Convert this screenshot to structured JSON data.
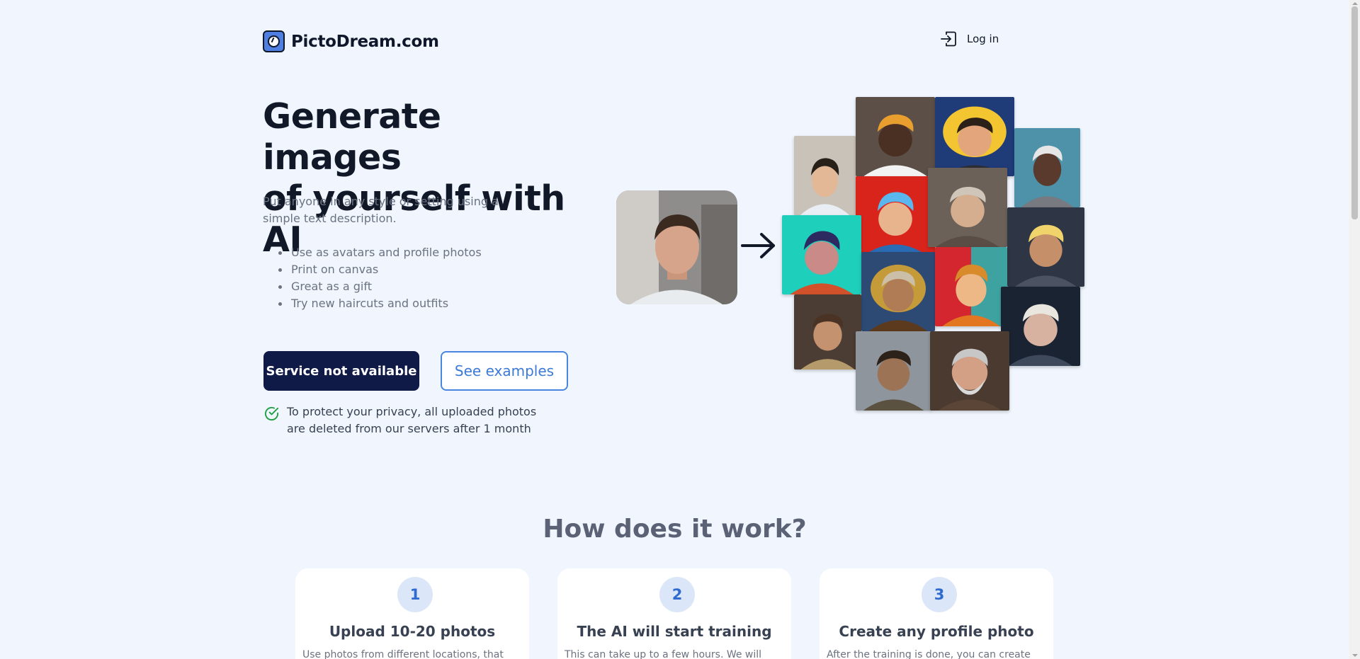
{
  "header": {
    "brand": "PictoDream.com",
    "login_label": "Log in"
  },
  "hero": {
    "title_line1": "Generate images",
    "title_line2": "of yourself with AI",
    "subtitle": "Put anyone in any style or setting using a simple text description.",
    "features": [
      "Use as avatars and profile photos",
      "Print on canvas",
      "Great as a gift",
      "Try new haircuts and outfits"
    ],
    "primary_button": "Service not available",
    "secondary_button": "See examples",
    "privacy_note": "To protect your privacy, all uploaded photos are deleted from our servers after 1 month"
  },
  "how": {
    "title": "How does it work?",
    "steps": [
      {
        "number": "1",
        "title": "Upload 10-20 photos",
        "text": "Use photos from different locations, that"
      },
      {
        "number": "2",
        "title": "The AI will start training",
        "text": "This can take up to a few hours. We will"
      },
      {
        "number": "3",
        "title": "Create any profile photo",
        "text": "After the training is done, you can create"
      }
    ]
  },
  "colors": {
    "background": "#f1f6fe",
    "primary_button": "#0f1a47",
    "accent": "#4a86e0",
    "check": "#22a047"
  },
  "icons": {
    "logo": "camera-lens-logo-icon",
    "login": "login-arrow-icon",
    "arrow": "right-arrow-icon",
    "privacy": "check-circle-icon"
  }
}
